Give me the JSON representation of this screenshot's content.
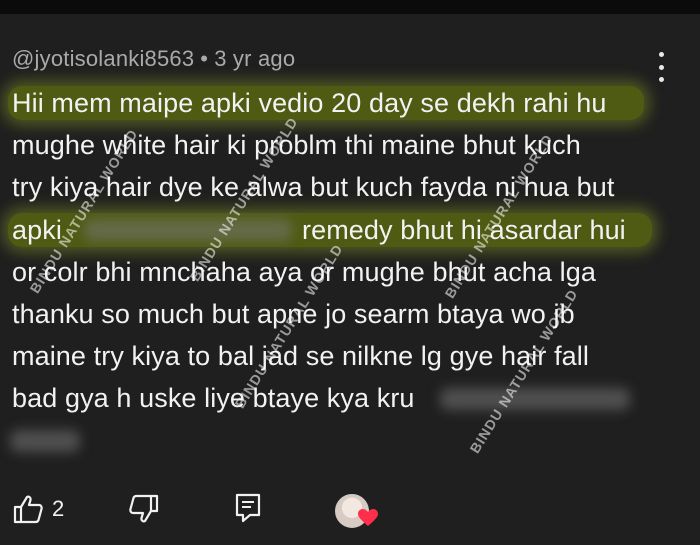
{
  "comment": {
    "author": "@jyotisolanki8563",
    "separator": "•",
    "time": "3 yr ago",
    "lines": [
      "Hii mem maipe apki vedio 20 day se dekh rahi hu",
      "mughe white hair ki problm thi maine bhut kuch",
      "try kiya hair dye ke alwa but kuch fayda ni hua but",
      "apki",
      "remedy bhut hi asardar hui",
      "or colr bhi mnchaha aya or mughe bhut acha lga",
      "thanku so much but apne jo searm btaya wo jb",
      "maine try kiya to bal jad se nilkne lg gye hair fall",
      "bad gya h uske liye btaye kya kru"
    ]
  },
  "watermark": "BINDU NATURAL WORLD",
  "actions": {
    "like_count": "2"
  },
  "colors": {
    "background": "#1f1f1f",
    "highlight": "#4f5a12",
    "meta_text": "#aaaaaa"
  }
}
